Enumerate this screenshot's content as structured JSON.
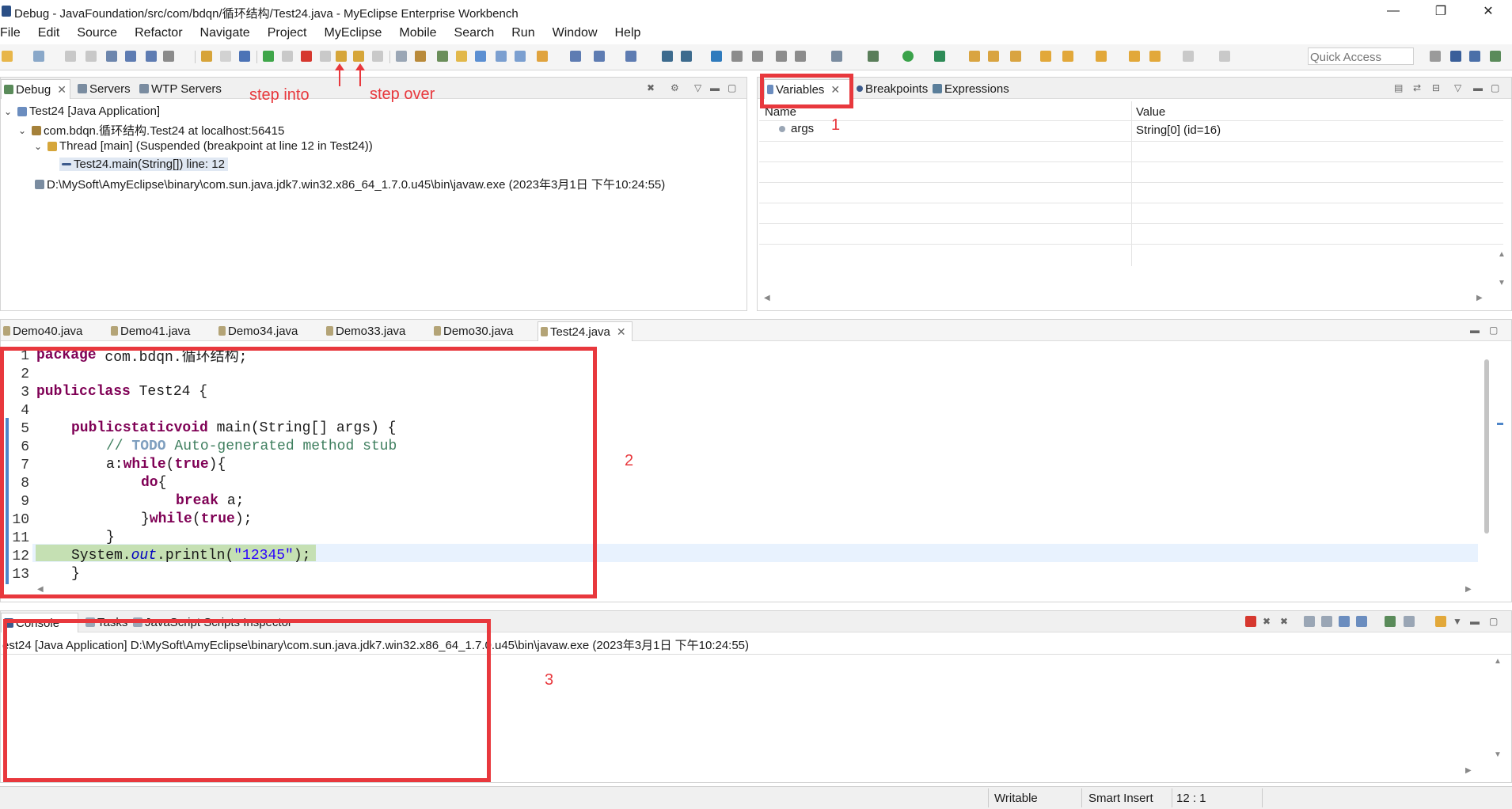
{
  "window": {
    "title": "Debug - JavaFoundation/src/com/bdqn/循环结构/Test24.java - MyEclipse Enterprise Workbench",
    "minimize": "—",
    "restore": "❐",
    "close": "✕"
  },
  "menu": [
    "File",
    "Edit",
    "Source",
    "Refactor",
    "Navigate",
    "Project",
    "MyEclipse",
    "Mobile",
    "Search",
    "Run",
    "Window",
    "Help"
  ],
  "toolbar": {
    "quick_access_placeholder": "Quick Access"
  },
  "debug_view": {
    "tabs": [
      "Debug",
      "Servers",
      "WTP Servers"
    ],
    "tree": {
      "app": "Test24 [Java Application]",
      "vm": "com.bdqn.循环结构.Test24 at localhost:56415",
      "thread": "Thread [main] (Suspended (breakpoint at line 12 in Test24))",
      "frame": "Test24.main(String[]) line: 12",
      "process": "D:\\MySoft\\AmyEclipse\\binary\\com.sun.java.jdk7.win32.x86_64_1.7.0.u45\\bin\\javaw.exe (2023年3月1日 下午10:24:55)"
    }
  },
  "variables_view": {
    "tabs": [
      "Variables",
      "Breakpoints",
      "Expressions"
    ],
    "columns": [
      "Name",
      "Value"
    ],
    "rows": [
      {
        "name": "args",
        "value": "String[0]  (id=16)"
      }
    ]
  },
  "editor": {
    "tabs": [
      "Demo40.java",
      "Demo41.java",
      "Demo34.java",
      "Demo33.java",
      "Demo30.java",
      "Test24.java"
    ],
    "line_numbers": [
      "1",
      "2",
      "3",
      "4",
      "5",
      "6",
      "7",
      "8",
      "9",
      "10",
      "11",
      "12",
      "13"
    ],
    "code": {
      "l1_kw": "package",
      "l1_rest": " com.bdqn.循环结构;",
      "l3_kw1": "public",
      "l3_kw2": "class",
      "l3_rest": " Test24 {",
      "l5_kw1": "public",
      "l5_kw2": "static",
      "l5_kw3": "void",
      "l5_rest": " main(String[] args) {",
      "l6_prefix": "// ",
      "l6_todo": "TODO",
      "l6_rest": " Auto-generated method stub",
      "l7_pre": "a:",
      "l7_kw1": "while",
      "l7_mid": "(",
      "l7_kw2": "true",
      "l7_end": "){",
      "l8_kw": "do",
      "l8_end": "{",
      "l9_kw": "break",
      "l9_rest": " a;",
      "l10_pre": "}",
      "l10_kw1": "while",
      "l10_mid": "(",
      "l10_kw2": "true",
      "l10_end": ");",
      "l11": "}",
      "l12_pre": "System.",
      "l12_fld": "out",
      "l12_mid": ".println(",
      "l12_str": "\"12345\"",
      "l12_end": ");",
      "l13": "}"
    }
  },
  "console_view": {
    "tabs": [
      "Console",
      "Tasks",
      "JavaScript Scripts Inspector"
    ],
    "description": "est24 [Java Application] D:\\MySoft\\AmyEclipse\\binary\\com.sun.java.jdk7.win32.x86_64_1.7.0.u45\\bin\\javaw.exe (2023年3月1日 下午10:24:55)"
  },
  "annotations": {
    "step_into": "step into",
    "step_over": "step over",
    "box1": "1",
    "box2": "2",
    "box3": "3",
    "color": "#e8383d"
  },
  "status_bar": {
    "mode": "Writable",
    "insert": "Smart Insert",
    "position": "12 : 1"
  }
}
